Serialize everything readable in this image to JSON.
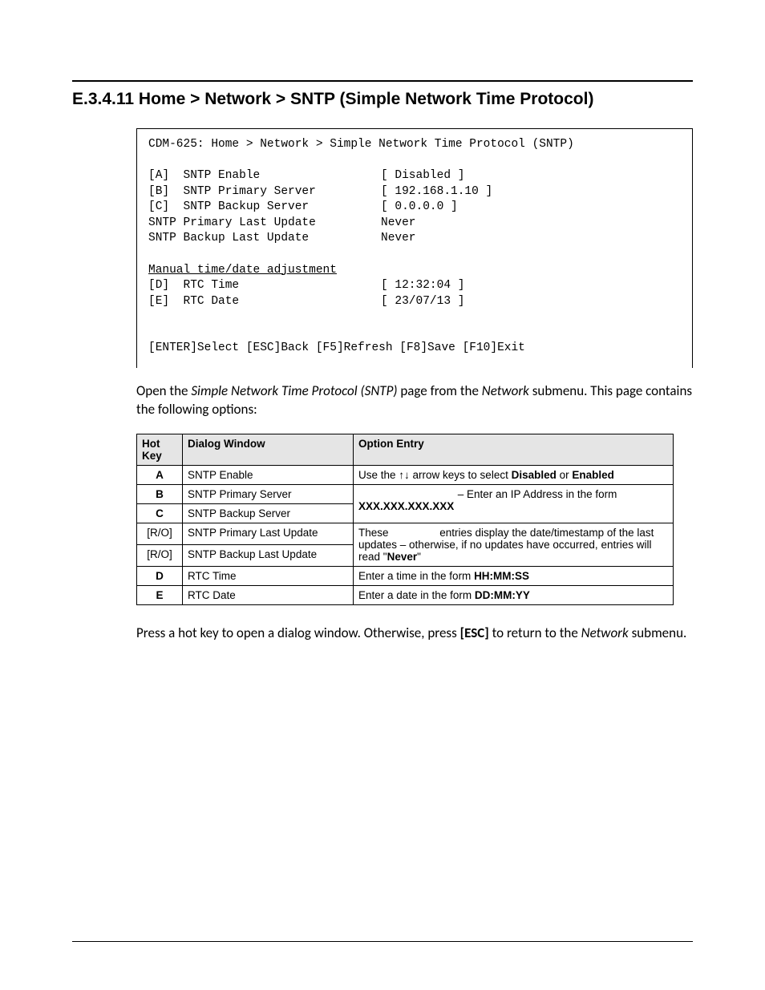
{
  "section": {
    "number": "E.3.4.11",
    "title": "Home > Network > SNTP (Simple Network Time Protocol)"
  },
  "terminal": {
    "header": "CDM-625: Home > Network > Simple Network Time Protocol (SNTP)",
    "rows": [
      {
        "label": "[A]  SNTP Enable",
        "value": "[ Disabled ]"
      },
      {
        "label": "[B]  SNTP Primary Server",
        "value": "[ 192.168.1.10 ]"
      },
      {
        "label": "[C]  SNTP Backup Server",
        "value": "[ 0.0.0.0 ]"
      },
      {
        "label": "SNTP Primary Last Update",
        "value": "Never"
      },
      {
        "label": "SNTP Backup Last Update",
        "value": "Never"
      }
    ],
    "manual_heading": "Manual time/date adjustment",
    "manual_rows": [
      {
        "label": "[D]  RTC Time",
        "value": "[ 12:32:04 ]"
      },
      {
        "label": "[E]  RTC Date",
        "value": "[ 23/07/13 ]"
      }
    ],
    "footer": "[ENTER]Select [ESC]Back [F5]Refresh [F8]Save [F10]Exit"
  },
  "intro": {
    "pre": "Open the ",
    "ital": "Simple Network Time Protocol (SNTP)",
    "mid": " page from the ",
    "ital2": "Network",
    "post": " submenu. This page contains the following options:"
  },
  "table": {
    "headers": {
      "hotkey": "Hot Key",
      "dialog": "Dialog Window",
      "option": "Option Entry"
    },
    "rows": {
      "a": {
        "key": "A",
        "dialog": "SNTP Enable",
        "opt_pre": "Use the ",
        "opt_arrows": "↑↓",
        "opt_mid": " arrow keys to select ",
        "opt_b1": "Disabled",
        "opt_or": " or ",
        "opt_b2": "Enabled"
      },
      "b": {
        "key": "B",
        "dialog": "SNTP Primary Server"
      },
      "c": {
        "key": "C",
        "dialog": "SNTP Backup Server"
      },
      "bc_opt": {
        "line1": " – Enter an IP Address in the form",
        "bold": "XXX.XXX.XXX.XXX"
      },
      "ro1": {
        "key": "[R/O]",
        "dialog": "SNTP Primary Last Update"
      },
      "ro2": {
        "key": "[R/O]",
        "dialog": "SNTP Backup Last Update"
      },
      "ro_opt": {
        "line1_pre": "These ",
        "line1_post": "entries display the date/timestamp of the last updates – otherwise, if no updates have occurred, entries will read \"",
        "bold": "Never",
        "tail": "\""
      },
      "d": {
        "key": "D",
        "dialog": "RTC Time",
        "opt_pre": "Enter a time in the form ",
        "opt_bold": "HH:MM:SS"
      },
      "e": {
        "key": "E",
        "dialog": "RTC Date",
        "opt_pre": "Enter a date in the form ",
        "opt_bold": "DD:MM:YY"
      }
    }
  },
  "outro": {
    "pre": "Press a hot key to open a dialog window. Otherwise, press ",
    "bold": "[ESC]",
    "mid": " to return to the ",
    "ital": "Network",
    "post": " submenu."
  }
}
